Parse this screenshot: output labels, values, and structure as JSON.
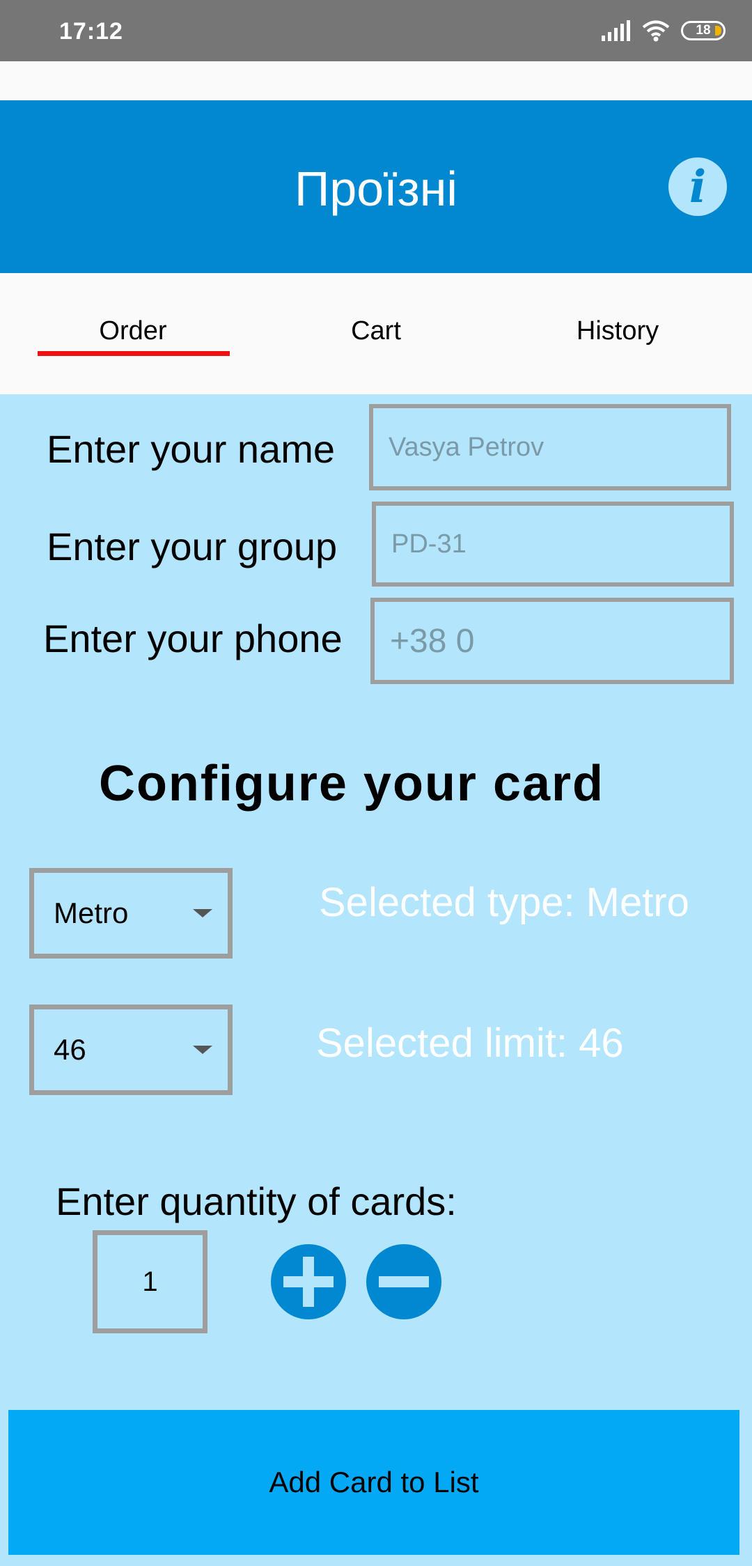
{
  "status_bar": {
    "time": "17:12",
    "battery": "18"
  },
  "app_bar": {
    "title": "Проїзні",
    "info_icon": "info-icon"
  },
  "tabs": [
    {
      "label": "Order",
      "selected": true
    },
    {
      "label": "Cart",
      "selected": false
    },
    {
      "label": "History",
      "selected": false
    }
  ],
  "form": {
    "name": {
      "label": "Enter your name",
      "placeholder": "Vasya Petrov"
    },
    "group": {
      "label": "Enter your group",
      "placeholder": "PD-31"
    },
    "phone": {
      "label": "Enter your phone",
      "placeholder": "+38 0"
    }
  },
  "configure": {
    "title": "Configure your card",
    "type_value": "Metro",
    "type_selected_text": "Selected type: Metro",
    "limit_value": "46",
    "limit_selected_text": "Selected limit: 46"
  },
  "quantity": {
    "label": "Enter quantity of cards:",
    "value": "1"
  },
  "add_button": {
    "label": "Add Card to List"
  },
  "colors": {
    "primary": "#0288d1",
    "background": "#b3e5fc",
    "tab_indicator": "#ee1111",
    "button": "#03a9f4"
  }
}
